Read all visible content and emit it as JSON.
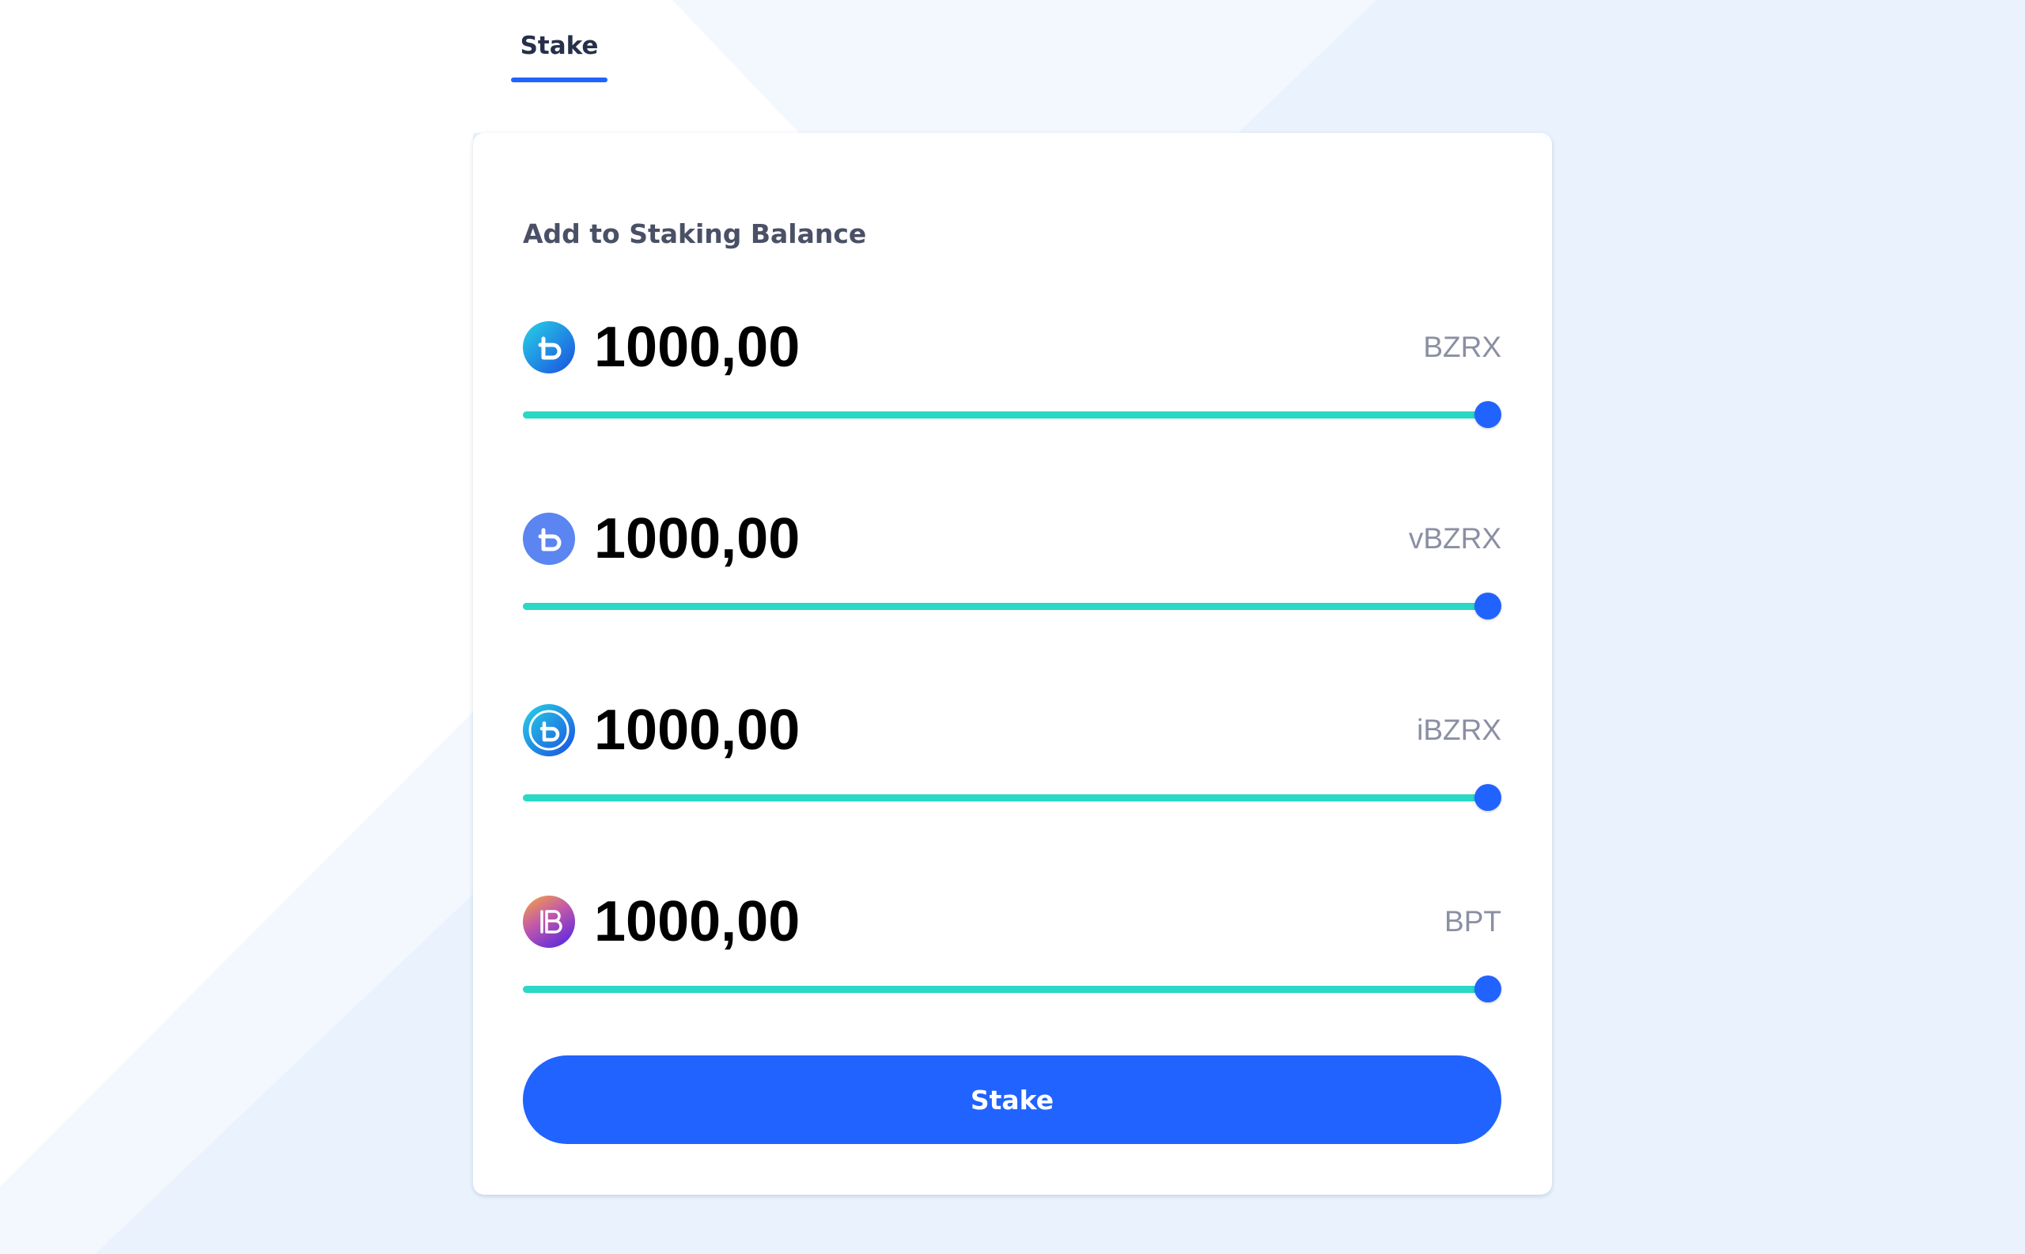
{
  "tabs": [
    {
      "label": "Stake",
      "active": true
    }
  ],
  "card": {
    "title": "Add to Staking Balance"
  },
  "tokens": [
    {
      "amount": "1000,00",
      "symbol": "BZRX",
      "icon": "bzrx-icon",
      "slider_fraction": 1.0
    },
    {
      "amount": "1000,00",
      "symbol": "vBZRX",
      "icon": "vbzrx-icon",
      "slider_fraction": 1.0
    },
    {
      "amount": "1000,00",
      "symbol": "iBZRX",
      "icon": "ibzrx-icon",
      "slider_fraction": 1.0
    },
    {
      "amount": "1000,00",
      "symbol": "BPT",
      "icon": "bpt-icon",
      "slider_fraction": 1.0
    }
  ],
  "actions": {
    "stake_label": "Stake"
  },
  "colors": {
    "accent": "#2163ff",
    "slider_fill": "#2ad8c6",
    "background": "#eaf3fd",
    "card": "#ffffff"
  }
}
